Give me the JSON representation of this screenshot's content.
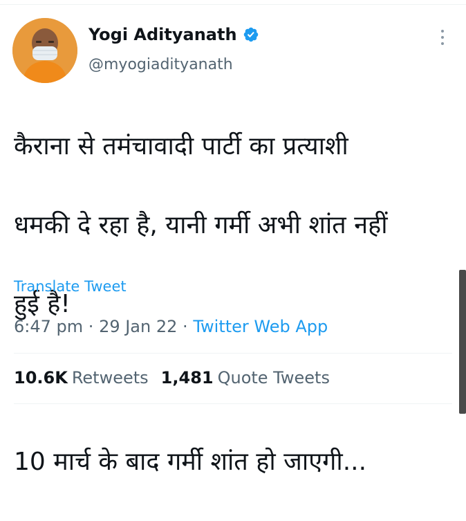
{
  "tweet": {
    "author": {
      "display_name": "Yogi Adityanath",
      "handle": "@myogiadityanath",
      "verified": true,
      "verified_color": "#1d9bf0"
    },
    "text_line_1": "कैराना से तमंचावादी पार्टी का प्रत्याशी",
    "text_line_2": "धमकी दे रहा है, यानी गर्मी अभी शांत नहीं",
    "text_line_3": "हुई है!",
    "text_line_4": "10 मार्च के बाद गर्मी शांत हो जाएगी...",
    "translate_label": "Translate Tweet",
    "time": "6:47 pm",
    "date": "29 Jan 22",
    "source": "Twitter Web App",
    "separator": "·",
    "retweets_count": "10.6K",
    "retweets_label": "Retweets",
    "quotes_count": "1,481",
    "quotes_label": "Quote Tweets"
  },
  "colors": {
    "link": "#1d9bf0",
    "secondary_text": "#536471",
    "primary_text": "#0f1419"
  },
  "icons": {
    "verified": "verified-badge-icon",
    "more": "more-options-icon"
  }
}
